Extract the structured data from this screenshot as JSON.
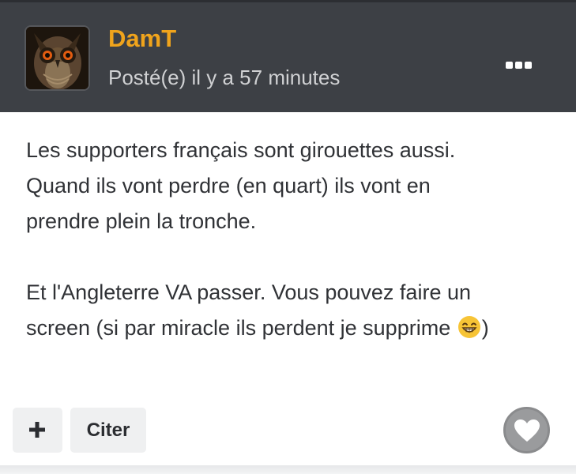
{
  "post": {
    "author": "DamT",
    "posted_time": "Posté(e) il y a 57 minutes",
    "body_lines": [
      "Les supporters français sont girouettes aussi.",
      "Quand ils vont perdre (en quart) ils vont en",
      "prendre plein la tronche.",
      "Et l'Angleterre VA passer. Vous pouvez faire un",
      "screen (si par miracle ils perdent je supprime ",
      ")"
    ],
    "emoji": "grinning-face-emoji"
  },
  "actions": {
    "plus_icon": "plus-icon",
    "quote_label": "Citer",
    "like_icon": "heart-icon",
    "more_icon": "more-options-icon"
  },
  "colors": {
    "header_bg": "#3d4045",
    "author": "#f0a41c",
    "text": "#303236"
  }
}
